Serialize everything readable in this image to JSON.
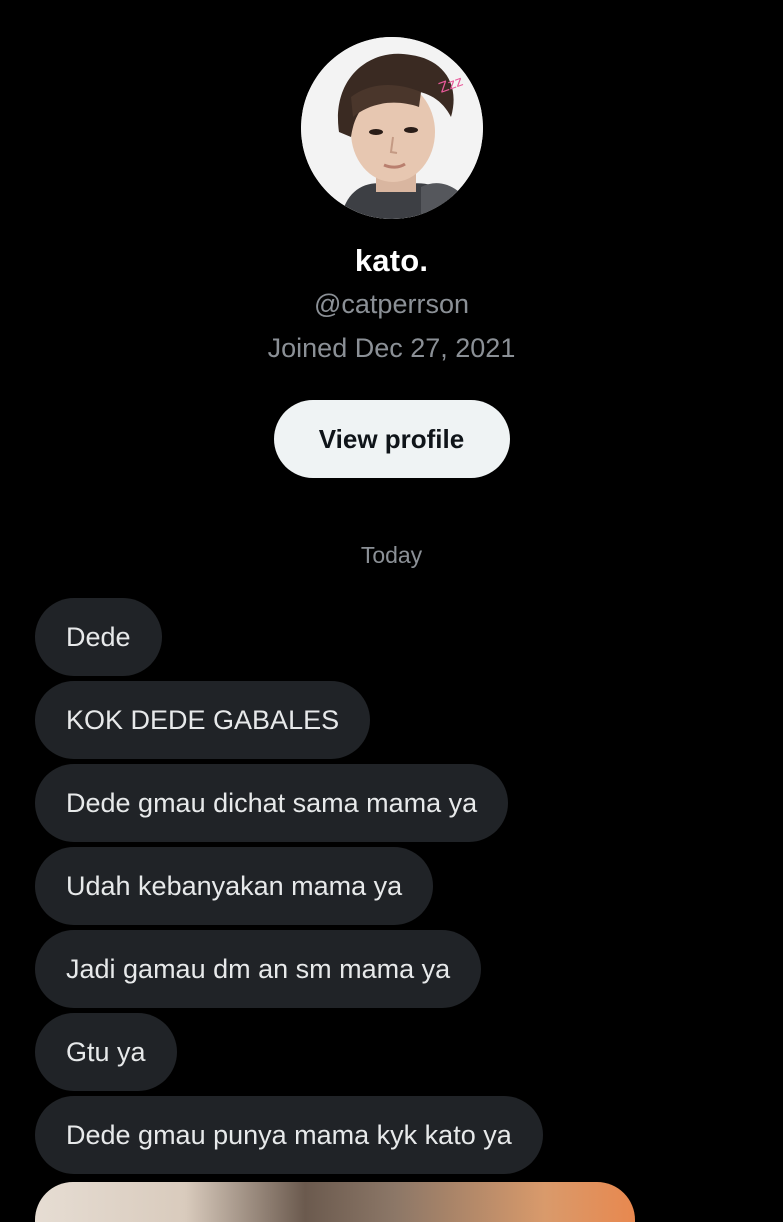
{
  "profile": {
    "display_name": "kato.",
    "handle": "@catperrson",
    "joined": "Joined Dec 27, 2021",
    "view_profile_label": "View profile",
    "avatar_sticker_text": "Zzz"
  },
  "conversation": {
    "date_divider": "Today",
    "messages": [
      {
        "text": "Dede"
      },
      {
        "text": "KOK DEDE GABALES"
      },
      {
        "text": "Dede gmau dichat sama mama ya"
      },
      {
        "text": "Udah kebanyakan mama ya"
      },
      {
        "text": "Jadi gamau dm an sm mama ya"
      },
      {
        "text": "Gtu ya"
      },
      {
        "text": "Dede gmau punya mama kyk kato ya"
      }
    ]
  },
  "colors": {
    "background": "#000000",
    "bubble": "#202327",
    "button_bg": "#eff3f4",
    "secondary_text": "#8b9096",
    "primary_text": "#e7e9ea"
  }
}
